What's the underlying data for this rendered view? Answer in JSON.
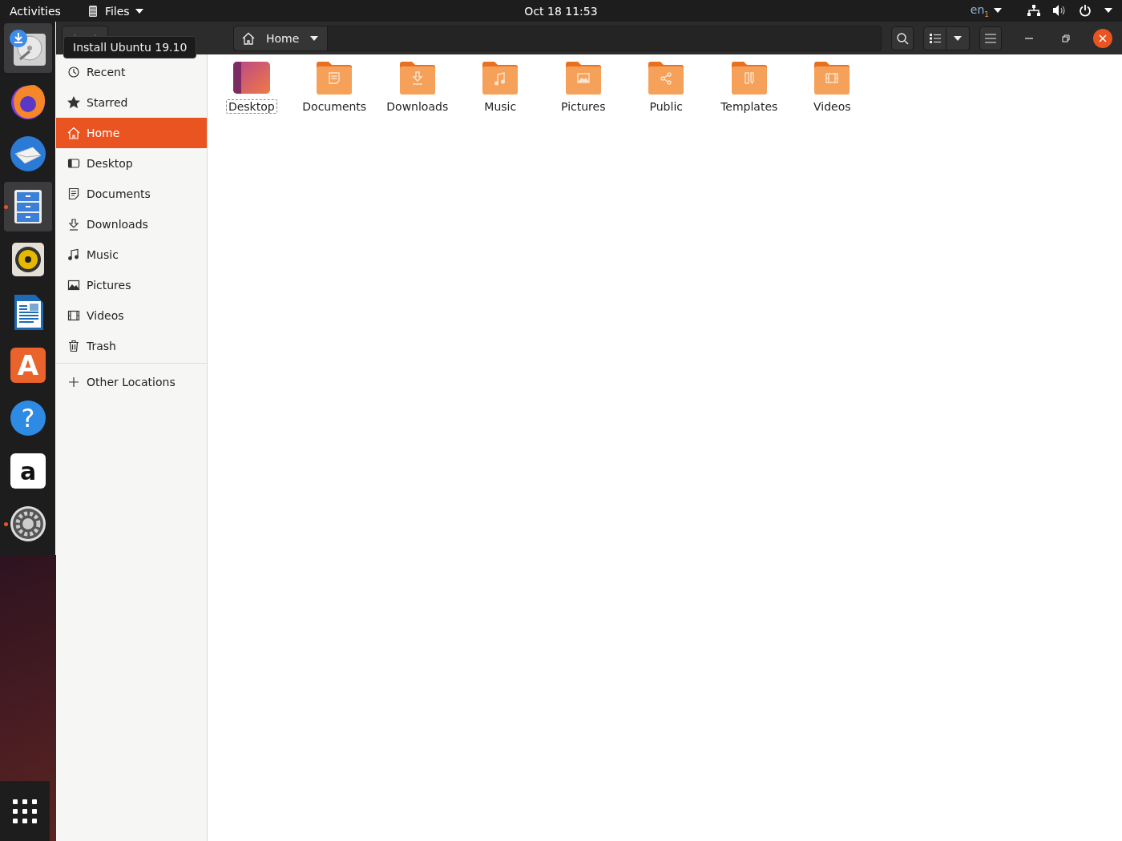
{
  "top_bar": {
    "activities": "Activities",
    "app_menu": {
      "label": "Files"
    },
    "clock": "Oct 18  11:53",
    "keyboard_layout": "en$_{1}$"
  },
  "dock": {
    "items": [
      {
        "kind": "installer",
        "highlighted": true,
        "running": false
      },
      {
        "kind": "browser",
        "highlighted": false,
        "running": false
      },
      {
        "kind": "mail",
        "highlighted": false,
        "running": false
      },
      {
        "kind": "files",
        "highlighted": true,
        "running": true
      },
      {
        "kind": "music",
        "highlighted": false,
        "running": false
      },
      {
        "kind": "writer",
        "highlighted": false,
        "running": false
      },
      {
        "kind": "store",
        "glyph": "A",
        "highlighted": false,
        "running": false
      },
      {
        "kind": "help",
        "glyph": "?",
        "highlighted": false,
        "running": false
      },
      {
        "kind": "amazon",
        "glyph": "a",
        "highlighted": false,
        "running": false
      },
      {
        "kind": "settings",
        "highlighted": false,
        "running": true
      }
    ]
  },
  "tooltip": "Install Ubuntu 19.10",
  "path_bar": {
    "location": "Home"
  },
  "sidebar": {
    "items": [
      {
        "kind": "recent",
        "label": "Recent",
        "selected": false
      },
      {
        "kind": "starred",
        "label": "Starred",
        "selected": false
      },
      {
        "kind": "home",
        "label": "Home",
        "selected": true
      },
      {
        "kind": "desktop",
        "label": "Desktop",
        "selected": false
      },
      {
        "kind": "documents",
        "label": "Documents",
        "selected": false
      },
      {
        "kind": "downloads",
        "label": "Downloads",
        "selected": false
      },
      {
        "kind": "music",
        "label": "Music",
        "selected": false
      },
      {
        "kind": "pictures",
        "label": "Pictures",
        "selected": false
      },
      {
        "kind": "videos",
        "label": "Videos",
        "selected": false
      },
      {
        "kind": "trash",
        "label": "Trash",
        "selected": false
      }
    ],
    "other": {
      "label": "Other Locations"
    }
  },
  "files": [
    {
      "kind": "desktop",
      "label": "Desktop",
      "focused": true
    },
    {
      "kind": "documents",
      "label": "Documents",
      "focused": false
    },
    {
      "kind": "downloads",
      "label": "Downloads",
      "focused": false
    },
    {
      "kind": "music",
      "label": "Music",
      "focused": false
    },
    {
      "kind": "pictures",
      "label": "Pictures",
      "focused": false
    },
    {
      "kind": "public",
      "label": "Public",
      "focused": false
    },
    {
      "kind": "templates",
      "label": "Templates",
      "focused": false
    },
    {
      "kind": "videos",
      "label": "Videos",
      "focused": false
    }
  ]
}
